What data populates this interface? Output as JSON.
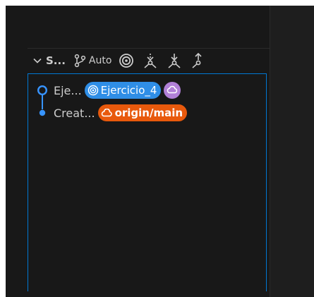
{
  "section": {
    "title": "S...",
    "auto_label": "Auto"
  },
  "icons": {
    "chevron": "chevron-down-icon",
    "branch": "git-branch-icon",
    "target": "target-icon",
    "fetch": "fetch-icon",
    "pull": "pull-icon",
    "push": "push-icon",
    "cloud": "cloud-icon"
  },
  "commits": [
    {
      "message": "Eje...",
      "ref_label": "Ejercicio_4",
      "ref_type": "local-branch"
    },
    {
      "message": "Creat...",
      "ref_label": "origin/main",
      "ref_type": "remote-branch"
    }
  ],
  "colors": {
    "accent_blue": "#2f8ee6",
    "remote_orange": "#e8590c",
    "cloud_purple": "#b180d7",
    "focus_border": "#0078d4"
  }
}
